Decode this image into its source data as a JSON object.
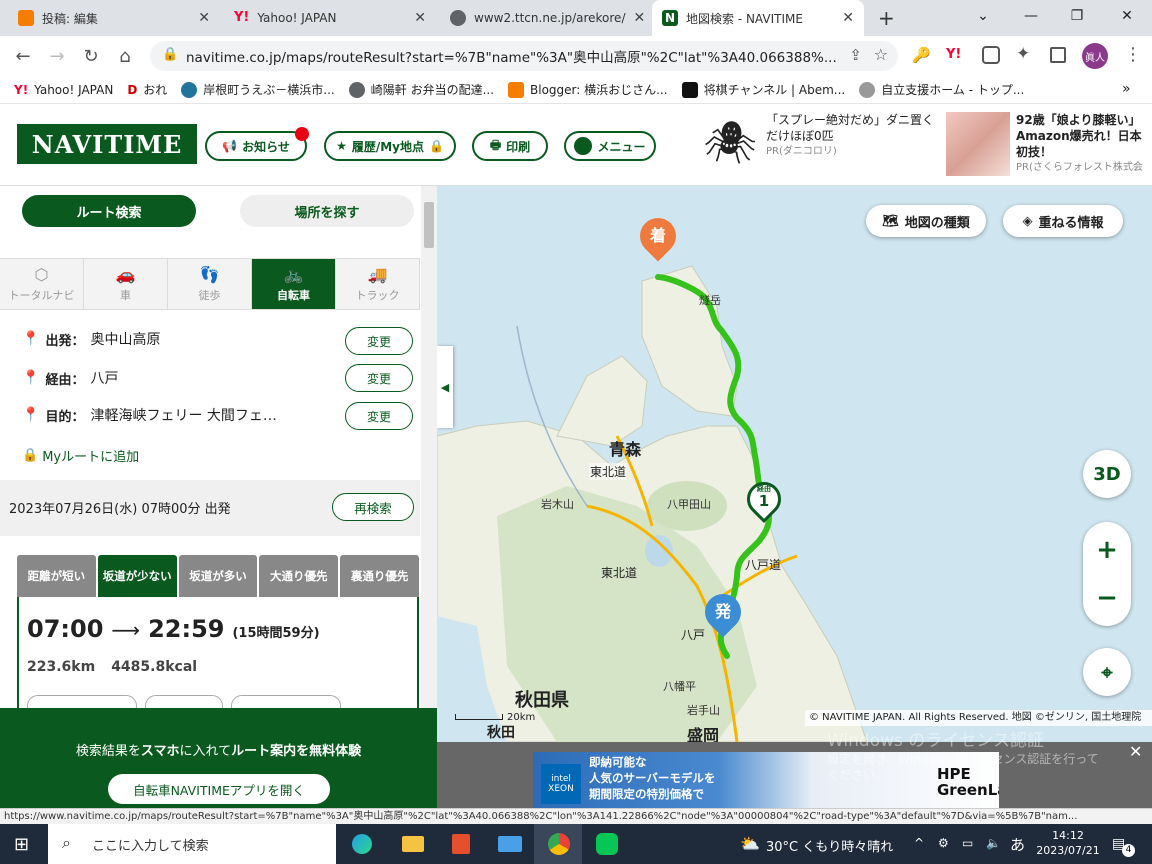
{
  "browser": {
    "tabs": [
      {
        "title": "投稿: 編集",
        "icon": "blogger-icon",
        "color": "#f57d00"
      },
      {
        "title": "Yahoo! JAPAN",
        "icon": "yahoo-icon",
        "color": "#ff0033"
      },
      {
        "title": "www2.ttcn.ne.jp/arekore/",
        "icon": "globe-icon",
        "color": "#5f6368"
      },
      {
        "title": "地図検索 - NAVITIME",
        "icon": "navitime-icon",
        "color": "#0a5a1f"
      }
    ],
    "active_tab": 3,
    "new_tab_glyph": "+",
    "url": "navitime.co.jp/maps/routeResult?start=%7B\"name\"%3A\"奥中山高原\"%2C\"lat\"%3A40.066388%...",
    "profile_label": "眞人",
    "bookmarks": [
      {
        "label": "Yahoo! JAPAN",
        "icon": "yahoo-icon"
      },
      {
        "label": "おれ",
        "icon": "d-icon"
      },
      {
        "label": "岸根町うえぶ－横浜市...",
        "icon": "wordpress-icon"
      },
      {
        "label": "崎陽軒 お弁当の配達...",
        "icon": "globe-icon"
      },
      {
        "label": "Blogger: 横浜おじさん...",
        "icon": "blogger-icon"
      },
      {
        "label": "将棋チャンネル | Abem...",
        "icon": "abema-icon"
      },
      {
        "label": "自立支援ホーム - トップ...",
        "icon": "home-icon"
      }
    ],
    "more_bookmarks": "»"
  },
  "header": {
    "logo": "NAVITIME",
    "notice_label": "お知らせ",
    "history_label": "履歴/My地点",
    "print_label": "印刷",
    "menu_label": "メニュー",
    "ad1": {
      "title": "「スプレー絶対だめ」ダニ置くだけほぼ0匹",
      "pr": "PR(ダニコロリ)"
    },
    "ad2": {
      "title": "92歳「娘より膝軽い」Amazon爆売れ！日本初技！",
      "pr": "PR(さくらフォレスト株式会"
    }
  },
  "panel": {
    "route_search_label": "ルート検索",
    "place_search_label": "場所を探す",
    "modes": [
      "トータルナビ",
      "車",
      "徒歩",
      "自転車",
      "トラック"
    ],
    "selected_mode": 3,
    "start_label": "出発：",
    "start_value": "奥中山高原",
    "via_label": "経由：",
    "via_value": "八戸",
    "dest_label": "目的：",
    "dest_value": "津軽海峡フェリー 大間フェ…",
    "change_label": "変更",
    "myroute_label": "Myルートに追加",
    "datetime": "2023年07月26日(水) 07時00分 出発",
    "research_label": "再検索",
    "route_tabs": [
      "距離が短い",
      "坂道が少ない",
      "坂道が多い",
      "大通り優先",
      "裏通り優先"
    ],
    "selected_route_tab": 1,
    "depart_time": "07:00",
    "arrow": "⟶",
    "arrive_time": "22:59",
    "duration": "(15時間59分)",
    "distance": "223.6km",
    "calories": "4485.8kcal"
  },
  "banner": {
    "text_pre": "検索結果を",
    "text_bold1": "スマホ",
    "text_mid": "に入れて",
    "text_bold2": "ルート案内を無料体験",
    "button_label": "自転車NAVITIMEアプリを開く"
  },
  "map": {
    "type_label": "地図の種類",
    "layers_label": "重ねる情報",
    "btn_3d": "3D",
    "zoom_in": "+",
    "zoom_out": "−",
    "scale_label": "20km",
    "copyright": "© NAVITIME JAPAN. All Rights Reserved. 地図 ©ゼンリン, 国土地理院",
    "pin_start": "発",
    "pin_end": "着",
    "pin_via": "1",
    "pin_via_small": "経由",
    "labels": [
      {
        "text": "青森",
        "cls": "big"
      },
      {
        "text": "東北道",
        "cls": "road"
      },
      {
        "text": "岩木山",
        "cls": "mt"
      },
      {
        "text": "八甲田山",
        "cls": "mt"
      },
      {
        "text": "東北道",
        "cls": "road"
      },
      {
        "text": "八戸道",
        "cls": "road"
      },
      {
        "text": "八戸",
        "cls": "road"
      },
      {
        "text": "八幡平",
        "cls": "mt"
      },
      {
        "text": "岩手山",
        "cls": "mt"
      },
      {
        "text": "秋田県",
        "cls": "pref"
      },
      {
        "text": "秋田",
        "cls": "big"
      },
      {
        "text": "盛岡",
        "cls": "big"
      },
      {
        "text": "燧岳",
        "cls": "mt"
      }
    ],
    "windows_watermark1": "Windows のライセンス認証",
    "windows_watermark2": "設定を開き、Windows のライセンス認証を行って",
    "windows_watermark3": "ください。"
  },
  "ad_bottom": {
    "intel": "intel XEON",
    "line1": "即納可能な",
    "line2": "人気のサーバーモデルを",
    "line3": "期間限定の特別価格で",
    "hpe": "HPE",
    "green": "GreenLa",
    "close": "✕"
  },
  "status_url": "https://www.navitime.co.jp/maps/routeResult?start=%7B\"name\"%3A\"奥中山高原\"%2C\"lat\"%3A40.066388%2C\"lon\"%3A141.22866%2C\"node\"%3A\"00000804\"%2C\"road-type\"%3A\"default\"%7D&via=%5B%7B\"nam...",
  "taskbar": {
    "search_placeholder": "ここに入力して検索",
    "weather": "30°C くもり時々晴れ",
    "ime": "あ",
    "time": "14:12",
    "date": "2023/07/21",
    "notif_count": "4"
  }
}
